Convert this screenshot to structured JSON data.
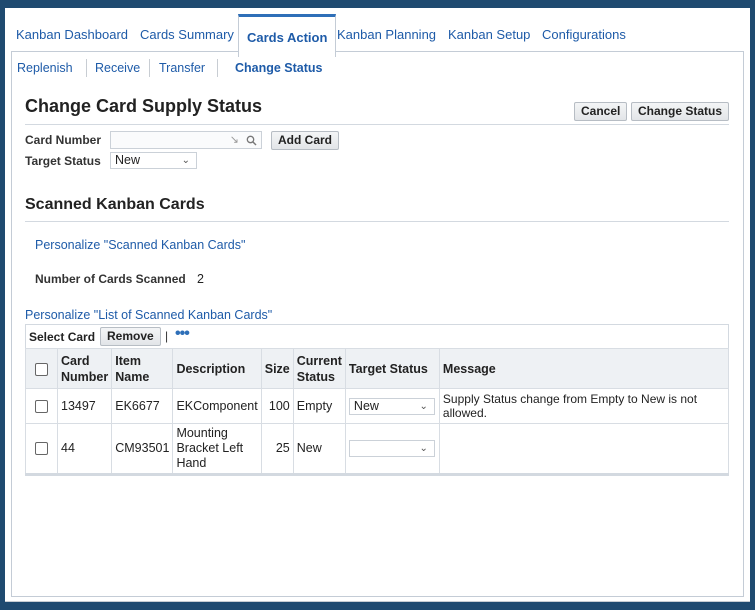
{
  "tabs": [
    {
      "label": "Kanban Dashboard",
      "active": false
    },
    {
      "label": "Cards Summary",
      "active": false
    },
    {
      "label": "Cards Action",
      "active": true
    },
    {
      "label": "Kanban Planning",
      "active": false
    },
    {
      "label": "Kanban Setup",
      "active": false
    },
    {
      "label": "Configurations",
      "active": false
    }
  ],
  "subtabs": [
    {
      "label": "Replenish",
      "active": false
    },
    {
      "label": "Receive",
      "active": false
    },
    {
      "label": "Transfer",
      "active": false
    },
    {
      "label": "Change Status",
      "active": true
    }
  ],
  "page": {
    "title": "Change Card Supply Status",
    "cancel_label": "Cancel",
    "change_status_label": "Change Status"
  },
  "form": {
    "card_number_label": "Card Number",
    "card_number_value": "",
    "add_card_label": "Add Card",
    "target_status_label": "Target Status",
    "target_status_value": "New"
  },
  "scanned": {
    "title": "Scanned Kanban Cards",
    "personalize_link": "Personalize \"Scanned Kanban Cards\"",
    "count_label": "Number of Cards Scanned",
    "count_value": "2",
    "list_personalize_link": "Personalize \"List of Scanned Kanban Cards\""
  },
  "toolbar": {
    "select_label": "Select Card",
    "remove_label": "Remove",
    "separator": "|",
    "more_icon": "more-dots-icon"
  },
  "table": {
    "headers": {
      "card_number": "Card Number",
      "item_name": "Item Name",
      "description": "Description",
      "size": "Size",
      "current_status": "Current Status",
      "target_status": "Target Status",
      "message": "Message"
    },
    "rows": [
      {
        "card_number": "13497",
        "item_name": "EK6677",
        "description": "EKComponent",
        "size": "100",
        "current_status": "Empty",
        "target_status": "New",
        "message": "Supply Status change from Empty to New is not allowed."
      },
      {
        "card_number": "44",
        "item_name": "CM93501",
        "description": "Mounting Bracket Left Hand",
        "size": "25",
        "current_status": "New",
        "target_status": "",
        "message": ""
      }
    ]
  }
}
